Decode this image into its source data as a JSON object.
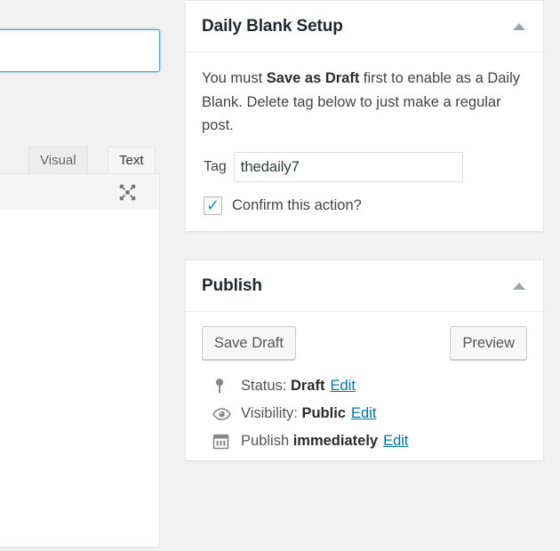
{
  "editor": {
    "title_value": "",
    "title_placeholder": "",
    "tabs": [
      {
        "label": "Visual",
        "active": false
      },
      {
        "label": "Text",
        "active": true
      }
    ],
    "fullscreen_icon": "fullscreen-expand-icon",
    "textarea_value": ""
  },
  "daily_blank_setup": {
    "title": "Daily Blank Setup",
    "toggle_icon": "chevron-up-icon",
    "description_part1": "You must ",
    "description_bold": "Save as Draft",
    "description_part2": " first to enable as a Daily Blank. Delete tag below to just make a regular post.",
    "tag_label": "Tag",
    "tag_value": "thedaily7",
    "tag_placeholder": "",
    "confirm_label": "Confirm this action?",
    "confirm_checked": true,
    "checkmark_glyph": "✓"
  },
  "publish": {
    "title": "Publish",
    "toggle_icon": "chevron-up-icon",
    "save_draft_label": "Save Draft",
    "preview_label": "Preview",
    "rows": [
      {
        "icon": "post-status-pin-icon",
        "prefix": "Status: ",
        "value": "Draft",
        "edit_label": "Edit"
      },
      {
        "icon": "visibility-eye-icon",
        "prefix": "Visibility: ",
        "value": "Public",
        "edit_label": "Edit"
      },
      {
        "icon": "calendar-icon",
        "prefix": "Publish ",
        "value": "immediately",
        "edit_label": "Edit"
      }
    ]
  },
  "colors": {
    "link": "#0073aa",
    "checkbox_tick": "#1e8cbe",
    "focus_border": "#5b9dd9",
    "page_background": "#f1f1f1",
    "panel_background": "#ffffff",
    "heading": "#23282d"
  }
}
